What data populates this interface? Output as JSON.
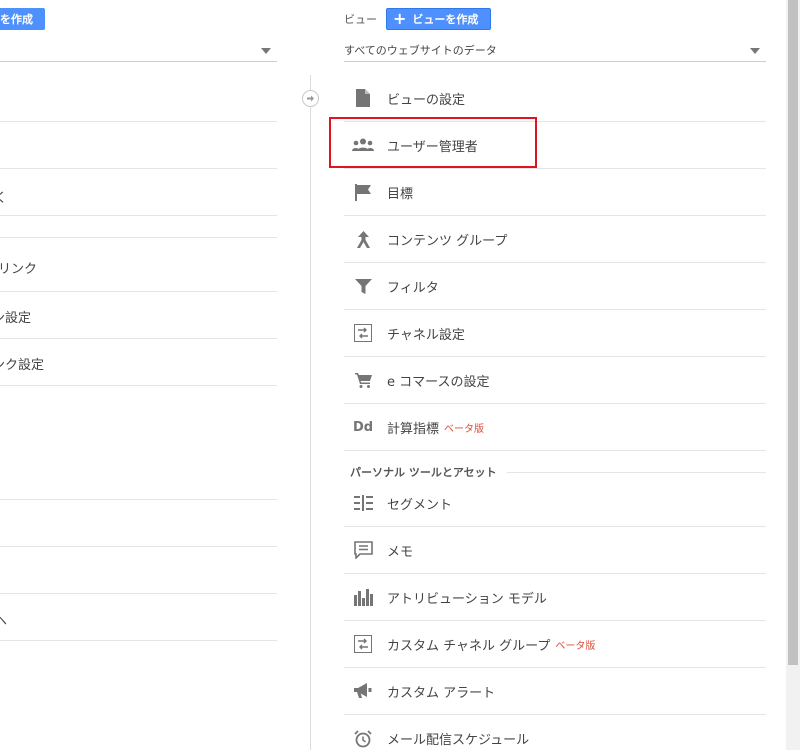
{
  "left": {
    "create_button": "を作成",
    "rows": [
      "リンク",
      "ン設定",
      "ンク設定",
      "ヘ"
    ]
  },
  "view": {
    "label": "ビュー",
    "create_button": "ビューを作成",
    "selected": "すべてのウェブサイトのデータ"
  },
  "menu": {
    "view_settings": "ビューの設定",
    "user_management": "ユーザー管理者",
    "goals": "目標",
    "content_grouping": "コンテンツ グループ",
    "filters": "フィルタ",
    "channel_settings": "チャネル設定",
    "ecommerce": "e コマースの設定",
    "calculated_metrics": "計算指標",
    "calculated_metrics_beta": "ベータ版",
    "section_personal": "パーソナル ツールとアセット",
    "segments": "セグメント",
    "notes": "メモ",
    "attribution": "アトリビューション モデル",
    "custom_channel": "カスタム チャネル グループ",
    "custom_channel_beta": "ベータ版",
    "custom_alerts": "カスタム アラート",
    "scheduled_emails": "メール配信スケジュール"
  },
  "icons": {
    "dd_label": "Dd"
  },
  "colors": {
    "accent": "#4d90fe",
    "highlight": "#e0141e",
    "beta": "#dd4b39"
  }
}
